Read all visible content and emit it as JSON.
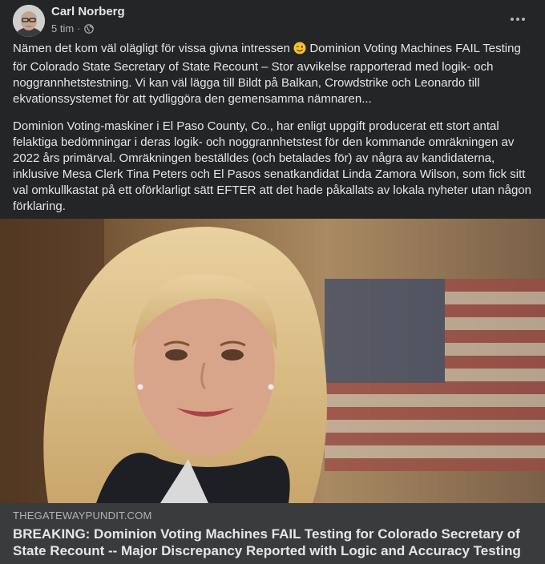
{
  "post": {
    "author": "Carl Norberg",
    "timestamp": "5 tim",
    "separator": "·",
    "privacy_icon": "globe-icon",
    "more_icon": "more-dots-icon",
    "paragraph1_before_emoji": "Nämen det kom väl olägligt för vissa givna intressen",
    "emoji": "winking-face-emoji",
    "paragraph1_after_emoji": "Dominion Voting Machines FAIL Testing för Colorado State Secretary of State Recount – Stor avvikelse rapporterad med logik- och noggrannhetstestning. Vi kan väl lägga till Bildt på Balkan, Crowdstrike och Leonardo till ekvationssystemet för att tydliggöra den gemensamma nämnaren...",
    "paragraph2": "Dominion Voting-maskiner i El Paso County, Co., har enligt uppgift producerat ett stort antal felaktiga bedömningar i deras logik- och noggrannhetstest för den kommande omräkningen av 2022 års primärval. Omräkningen beställdes (och betalades för) av några av kandidaterna, inklusive Mesa Clerk Tina Peters och El Pasos senatkandidat Linda Zamora Wilson, som fick sitt val omkullkastat på ett oförklarligt sätt EFTER att det hade påkallats av lokala nyheter utan någon förklaring."
  },
  "link_preview": {
    "domain": "THEGATEWAYPUNDIT.COM",
    "headline": "BREAKING: Dominion Voting Machines FAIL Testing for Colorado Secretary of State Recount -- Major Discrepancy Reported with Logic and Accuracy Testing"
  },
  "colors": {
    "background": "#242526",
    "link_background": "#3a3b3c",
    "text_primary": "#e4e6eb",
    "text_secondary": "#b0b3b8"
  }
}
